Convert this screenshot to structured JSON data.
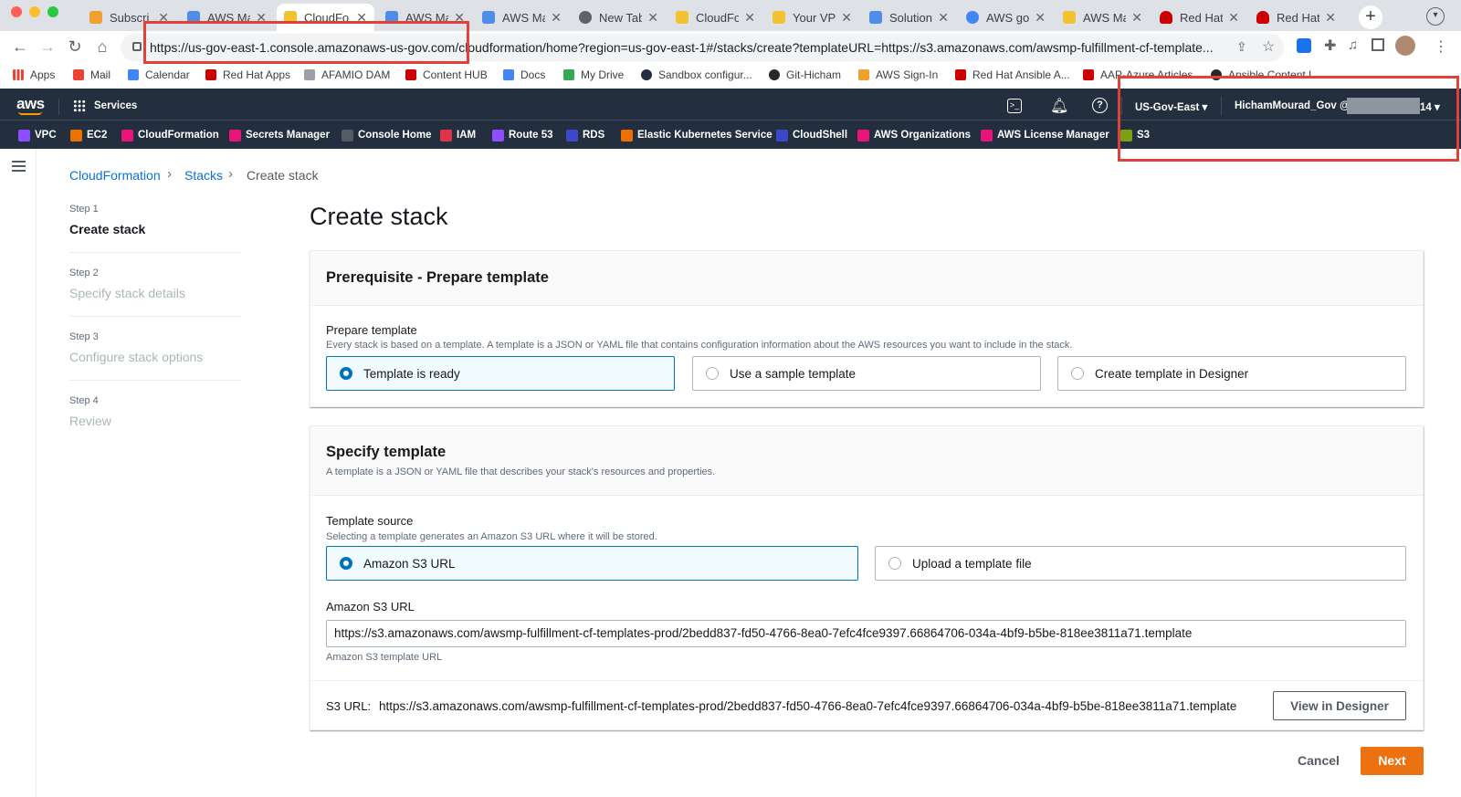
{
  "browser": {
    "tabs": [
      {
        "title": "Subscri",
        "icon_color": "#f0a030"
      },
      {
        "title": "AWS Ma",
        "icon_color": "#4e8ee8"
      },
      {
        "title": "CloudFo",
        "icon_color": "#f2c230"
      },
      {
        "title": "AWS Ma",
        "icon_color": "#4e8ee8"
      },
      {
        "title": "AWS Mar",
        "icon_color": "#4e8ee8"
      },
      {
        "title": "New Tab",
        "icon_color": "#5f6368"
      },
      {
        "title": "CloudFor",
        "icon_color": "#f2c230"
      },
      {
        "title": "Your VPC",
        "icon_color": "#f2c230"
      },
      {
        "title": "Solution",
        "icon_color": "#4e8ee8"
      },
      {
        "title": "AWS gov",
        "icon_color": "#4285f4"
      },
      {
        "title": "AWS Mar",
        "icon_color": "#f2c230"
      },
      {
        "title": "Red Hat",
        "icon_color": "#cc0000"
      },
      {
        "title": "Red Hat",
        "icon_color": "#cc0000"
      }
    ],
    "url": "https://us-gov-east-1.console.amazonaws-us-gov.com/cloudformation/home?region=us-gov-east-1#/stacks/create?templateURL=https://s3.amazonaws.com/awsmp-fulfillment-cf-template...",
    "bookmarks": [
      "Apps",
      "Mail",
      "Calendar",
      "Red Hat Apps",
      "AFAMIO DAM",
      "Content HUB",
      "Docs",
      "My Drive",
      "Sandbox configur...",
      "Git-Hicham",
      "AWS Sign-In",
      "Red Hat Ansible A...",
      "AAP-Azure Articles",
      "Ansible Content I"
    ]
  },
  "aws": {
    "logo": "aws",
    "services_label": "Services",
    "region": "US-Gov-East",
    "account": "HichamMourad_Gov @",
    "account_suffix": "14",
    "favorites": [
      "VPC",
      "EC2",
      "CloudFormation",
      "Secrets Manager",
      "Console Home",
      "IAM",
      "Route 53",
      "RDS",
      "Elastic Kubernetes Service",
      "CloudShell",
      "AWS Organizations",
      "AWS License Manager",
      "S3"
    ],
    "favorite_colors": [
      "#8c4fff",
      "#ed7100",
      "#e7157b",
      "#e7157b",
      "#545b64",
      "#dd344c",
      "#8c4fff",
      "#3b48cc",
      "#ed7100",
      "#3b48cc",
      "#e7157b",
      "#e7157b",
      "#7aa116"
    ]
  },
  "breadcrumb": {
    "items": [
      "CloudFormation",
      "Stacks"
    ],
    "current": "Create stack"
  },
  "steps": [
    {
      "label": "Step 1",
      "title": "Create stack"
    },
    {
      "label": "Step 2",
      "title": "Specify stack details"
    },
    {
      "label": "Step 3",
      "title": "Configure stack options"
    },
    {
      "label": "Step 4",
      "title": "Review"
    }
  ],
  "page_title": "Create stack",
  "prereq": {
    "header": "Prerequisite - Prepare template",
    "label": "Prepare template",
    "desc": "Every stack is based on a template. A template is a JSON or YAML file that contains configuration information about the AWS resources you want to include in the stack.",
    "options": [
      "Template is ready",
      "Use a sample template",
      "Create template in Designer"
    ],
    "selected": "Template is ready"
  },
  "specify": {
    "header": "Specify template",
    "subtitle": "A template is a JSON or YAML file that describes your stack's resources and properties.",
    "source_label": "Template source",
    "source_desc": "Selecting a template generates an Amazon S3 URL where it will be stored.",
    "options": [
      "Amazon S3 URL",
      "Upload a template file"
    ],
    "selected": "Amazon S3 URL",
    "url_label": "Amazon S3 URL",
    "url_value": "https://s3.amazonaws.com/awsmp-fulfillment-cf-templates-prod/2bedd837-fd50-4766-8ea0-7efc4fce9397.66864706-034a-4bf9-b5be-818ee3811a71.template",
    "url_hint": "Amazon S3 template URL",
    "s3_label": "S3 URL:",
    "s3_value": "https://s3.amazonaws.com/awsmp-fulfillment-cf-templates-prod/2bedd837-fd50-4766-8ea0-7efc4fce9397.66864706-034a-4bf9-b5be-818ee3811a71.template",
    "designer_button": "View in Designer"
  },
  "actions": {
    "cancel": "Cancel",
    "next": "Next"
  },
  "colors": {
    "aws_nav": "#232f3e",
    "accent": "#ec7211",
    "link": "#0972d3",
    "highlight": "#e0413a"
  }
}
